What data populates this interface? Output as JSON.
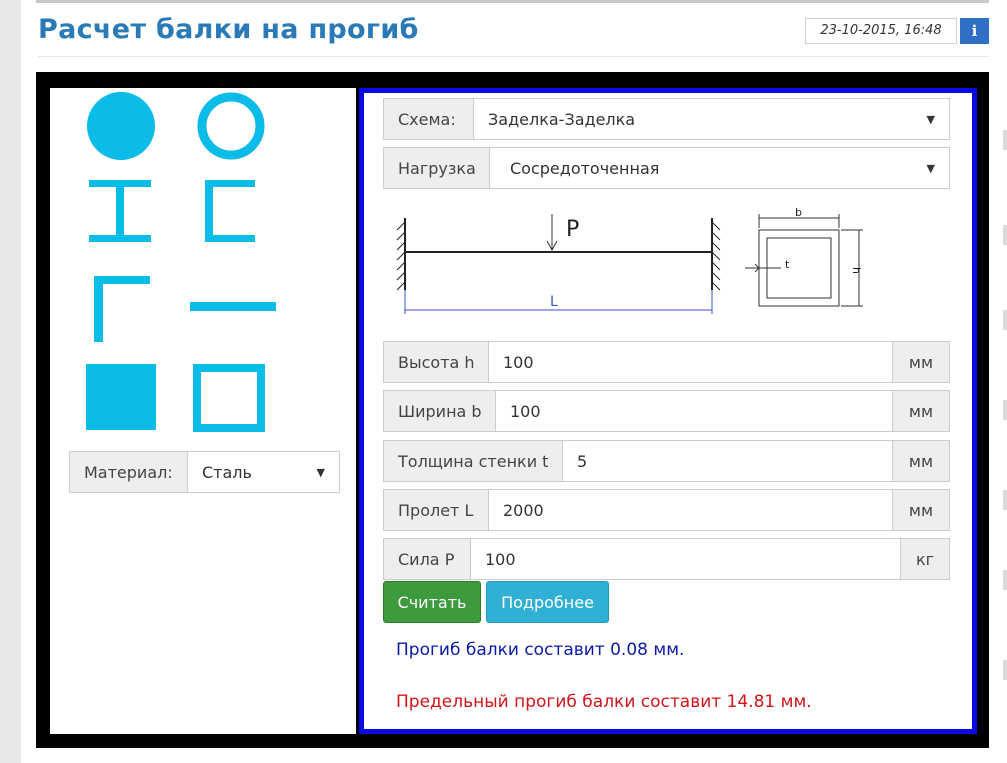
{
  "header": {
    "title": "Расчет балки на прогиб",
    "timestamp": "23-10-2015, 16:48",
    "info_label": "i"
  },
  "sections": {
    "shapes": [
      "round-bar-icon",
      "round-tube-icon",
      "i-beam-icon",
      "channel-icon",
      "angle-icon",
      "flat-bar-icon",
      "square-bar-icon",
      "square-tube-icon"
    ],
    "material": {
      "label": "Материал:",
      "value": "Сталь"
    }
  },
  "form": {
    "scheme": {
      "label": "Схема:",
      "value": "Заделка-Заделка"
    },
    "load": {
      "label": "Нагрузка",
      "value": "Сосредоточенная"
    },
    "diagram": {
      "force_label": "P",
      "span_label": "L",
      "width_label": "b",
      "height_label": "h",
      "wall_label": "t"
    },
    "height": {
      "label": "Высота h",
      "value": "100",
      "unit": "мм"
    },
    "width": {
      "label": "Ширина b",
      "value": "100",
      "unit": "мм"
    },
    "wall": {
      "label": "Толщина стенки t",
      "value": "5",
      "unit": "мм"
    },
    "span": {
      "label": "Пролет L",
      "value": "2000",
      "unit": "мм"
    },
    "force": {
      "label": "Сила P",
      "value": "100",
      "unit": "кг"
    },
    "calc_button": "Считать",
    "details_button": "Подробнее"
  },
  "results": {
    "deflection": "Прогиб балки составит 0.08 мм.",
    "limit": "Предельный прогиб балки составит 14.81 мм."
  },
  "colors": {
    "accent": "#2a7ab8",
    "shape_fill": "#0bbbe8",
    "panel_border": "#0a0ae6",
    "result_blue": "#0a1aa8",
    "result_red": "#d0141a"
  }
}
